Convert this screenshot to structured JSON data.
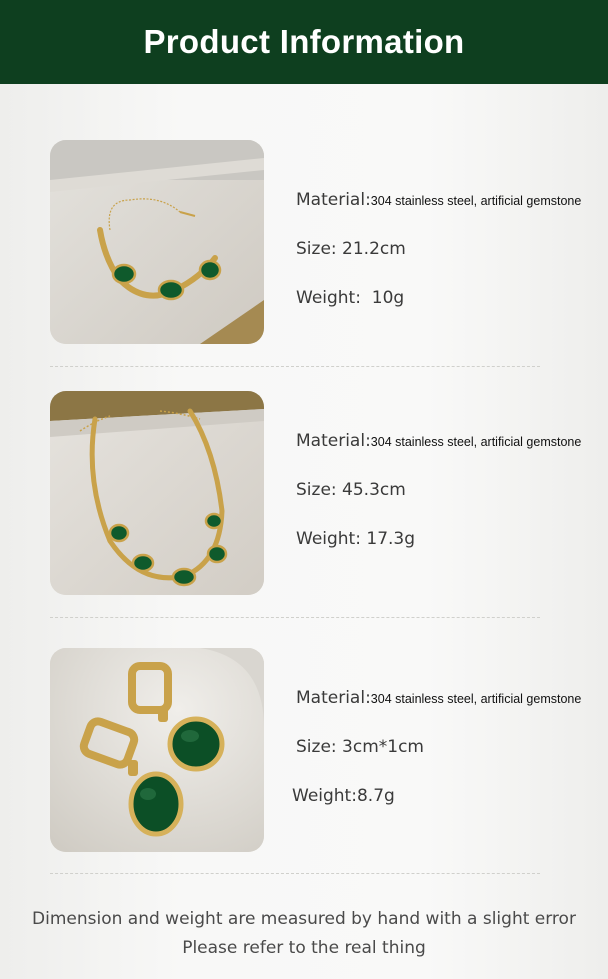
{
  "header": {
    "title": "Product Information"
  },
  "products": [
    {
      "material_label": "Material:",
      "material_value": "304 stainless steel, artificial gemstone",
      "size_label": "Size:",
      "size_value": "21.2cm",
      "weight_label": "Weight:",
      "weight_value": "10g"
    },
    {
      "material_label": "Material:",
      "material_value": "304 stainless steel, artificial gemstone",
      "size_label": "Size:",
      "size_value": "45.3cm",
      "weight_label": "Weight:",
      "weight_value": "17.3g"
    },
    {
      "material_label": "Material:",
      "material_value": "304 stainless steel, artificial gemstone",
      "size_label": "Size:",
      "size_value": "3cm*1cm",
      "weight_label": "Weight:",
      "weight_value": "8.7g"
    }
  ],
  "footer": {
    "line1": "Dimension and weight are measured by hand with a slight error",
    "line2": "Please refer to the real thing"
  },
  "colors": {
    "header_bg": "#0e3f1f",
    "gold": "#c9a24a",
    "emerald": "#0f5a2c"
  }
}
